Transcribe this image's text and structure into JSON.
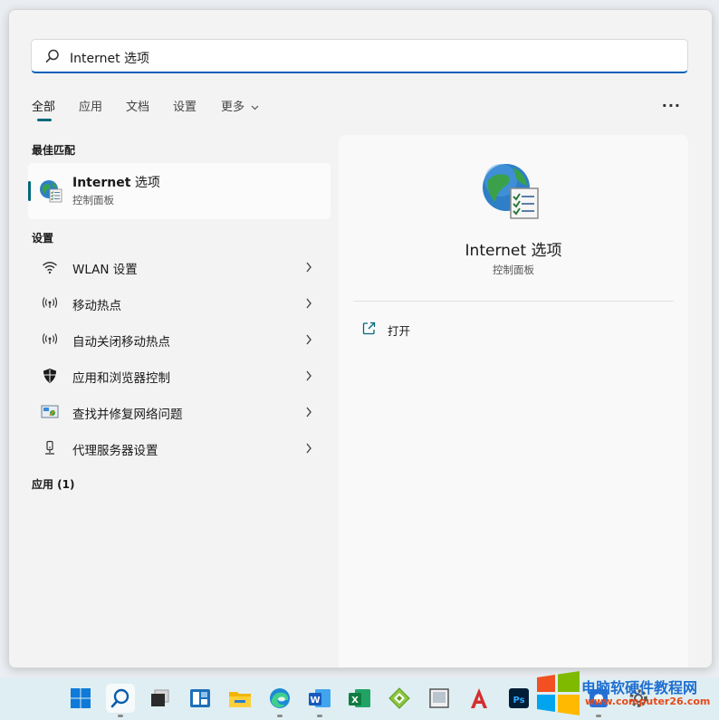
{
  "search": {
    "query": "Internet 选项"
  },
  "tabs": [
    {
      "label": "全部",
      "active": true
    },
    {
      "label": "应用"
    },
    {
      "label": "文档"
    },
    {
      "label": "设置"
    },
    {
      "label": "更多"
    }
  ],
  "more_menu_glyph": "···",
  "best_match": {
    "section_label": "最佳匹配",
    "title": "Internet",
    "title_suffix": "选项",
    "subtitle": "控制面板"
  },
  "settings": {
    "section_label": "设置",
    "items": [
      {
        "label": "WLAN 设置",
        "icon": "wifi-icon"
      },
      {
        "label": "移动热点",
        "icon": "hotspot-icon"
      },
      {
        "label": "自动关闭移动热点",
        "icon": "hotspot-icon"
      },
      {
        "label": "应用和浏览器控制",
        "icon": "shield-icon"
      },
      {
        "label": "查找并修复网络问题",
        "icon": "network-troubleshoot-icon"
      },
      {
        "label": "代理服务器设置",
        "icon": "proxy-icon"
      }
    ]
  },
  "apps_section_label": "应用 (1)",
  "detail": {
    "title": "Internet 选项",
    "subtitle": "控制面板",
    "actions": [
      {
        "label": "打开",
        "icon": "open-external-icon"
      }
    ]
  },
  "taskbar": {
    "icons": [
      "windows-start-icon",
      "search-icon",
      "task-view-icon",
      "widgets-icon",
      "file-explorer-icon",
      "edge-icon",
      "word-icon",
      "excel-icon",
      "app-green-icon",
      "app-window-icon",
      "app-red-a-icon",
      "photoshop-icon",
      "app-blue-icon",
      "settings-icon"
    ]
  },
  "watermark": {
    "line1": "电脑软硬件教程网",
    "line2": "www.computer26.com"
  },
  "colors": {
    "accent": "#00687a",
    "search_underline": "#005fb8",
    "panel": "#f3f3f3"
  }
}
